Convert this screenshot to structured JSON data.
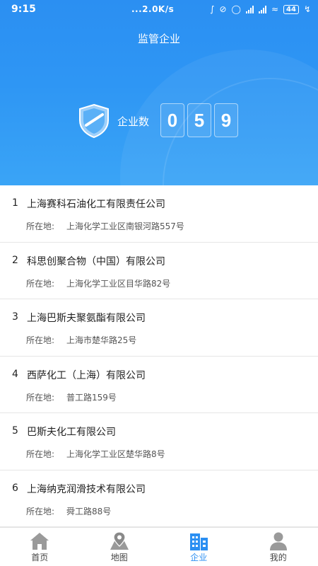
{
  "status": {
    "time": "9:15",
    "network": "...2.0K/s",
    "battery": "44"
  },
  "header": {
    "title": "监管企业",
    "count_label": "企业数",
    "digits": [
      "0",
      "5",
      "9"
    ]
  },
  "companies": [
    {
      "num": "1",
      "name": "上海赛科石油化工有限责任公司",
      "addr_label": "所在地:",
      "address": "上海化学工业区南银河路557号"
    },
    {
      "num": "2",
      "name": "科思创聚合物（中国）有限公司",
      "addr_label": "所在地:",
      "address": "上海化学工业区目华路82号"
    },
    {
      "num": "3",
      "name": "上海巴斯夫聚氨酯有限公司",
      "addr_label": "所在地:",
      "address": "上海市楚华路25号"
    },
    {
      "num": "4",
      "name": "西萨化工（上海）有限公司",
      "addr_label": "所在地:",
      "address": "普工路159号"
    },
    {
      "num": "5",
      "name": "巴斯夫化工有限公司",
      "addr_label": "所在地:",
      "address": "上海化学工业区楚华路8号"
    },
    {
      "num": "6",
      "name": "上海纳克润滑技术有限公司",
      "addr_label": "所在地:",
      "address": "舜工路88号"
    }
  ],
  "tabs": [
    {
      "label": "首页",
      "icon": "home-icon"
    },
    {
      "label": "地图",
      "icon": "map-icon"
    },
    {
      "label": "企业",
      "icon": "company-icon",
      "active": true
    },
    {
      "label": "我的",
      "icon": "user-icon"
    }
  ],
  "colors": {
    "primary": "#2b8ff2",
    "inactive_icon": "#9a9a9a"
  }
}
